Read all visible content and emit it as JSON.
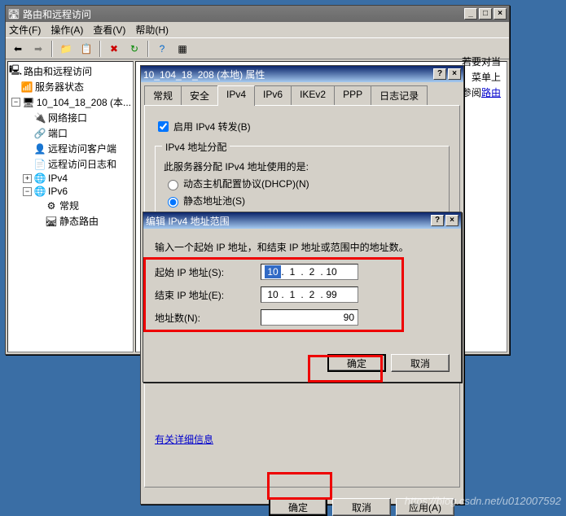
{
  "main_window": {
    "title": "路由和远程访问",
    "menu": {
      "file": "文件(F)",
      "action": "操作(A)",
      "view": "查看(V)",
      "help": "帮助(H)"
    },
    "tree": {
      "root": "路由和远程访问",
      "status": "服务器状态",
      "server": "10_104_18_208 (本...",
      "items": [
        "网络接口",
        "端口",
        "远程访问客户端",
        "远程访问日志和"
      ],
      "ipv4": "IPv4",
      "ipv6": "IPv6",
      "ipv6_children": [
        "常规",
        "静态路由"
      ]
    },
    "content_hint": [
      "若要对当",
      "菜单上",
      "参阅",
      "路由"
    ]
  },
  "prop": {
    "title": "10_104_18_208 (本地) 属性",
    "tabs": [
      "常规",
      "安全",
      "IPv4",
      "IPv6",
      "IKEv2",
      "PPP",
      "日志记录"
    ],
    "active_tab": 2,
    "enable_forward": "启用 IPv4 转发(B)",
    "groupbox_legend": "IPv4 地址分配",
    "group_desc": "此服务器分配 IPv4 地址使用的是:",
    "radio_dhcp": "动态主机配置协议(DHCP)(N)",
    "radio_static": "静态地址池(S)",
    "more_info": "有关详细信息",
    "buttons": {
      "ok": "确定",
      "cancel": "取消",
      "apply": "应用(A)"
    }
  },
  "dlg": {
    "title": "编辑 IPv4 地址范围",
    "instr": "输入一个起始 IP 地址，和结束 IP 地址或范围中的地址数。",
    "start_label": "起始 IP 地址(S):",
    "end_label": "结束 IP 地址(E):",
    "count_label": "地址数(N):",
    "start_ip": [
      "10",
      "1",
      "2",
      "10"
    ],
    "end_ip": [
      "10",
      "1",
      "2",
      "99"
    ],
    "count": "90",
    "ok": "确定",
    "cancel": "取消"
  },
  "watermark": "https://blog.csdn.net/u012007592"
}
